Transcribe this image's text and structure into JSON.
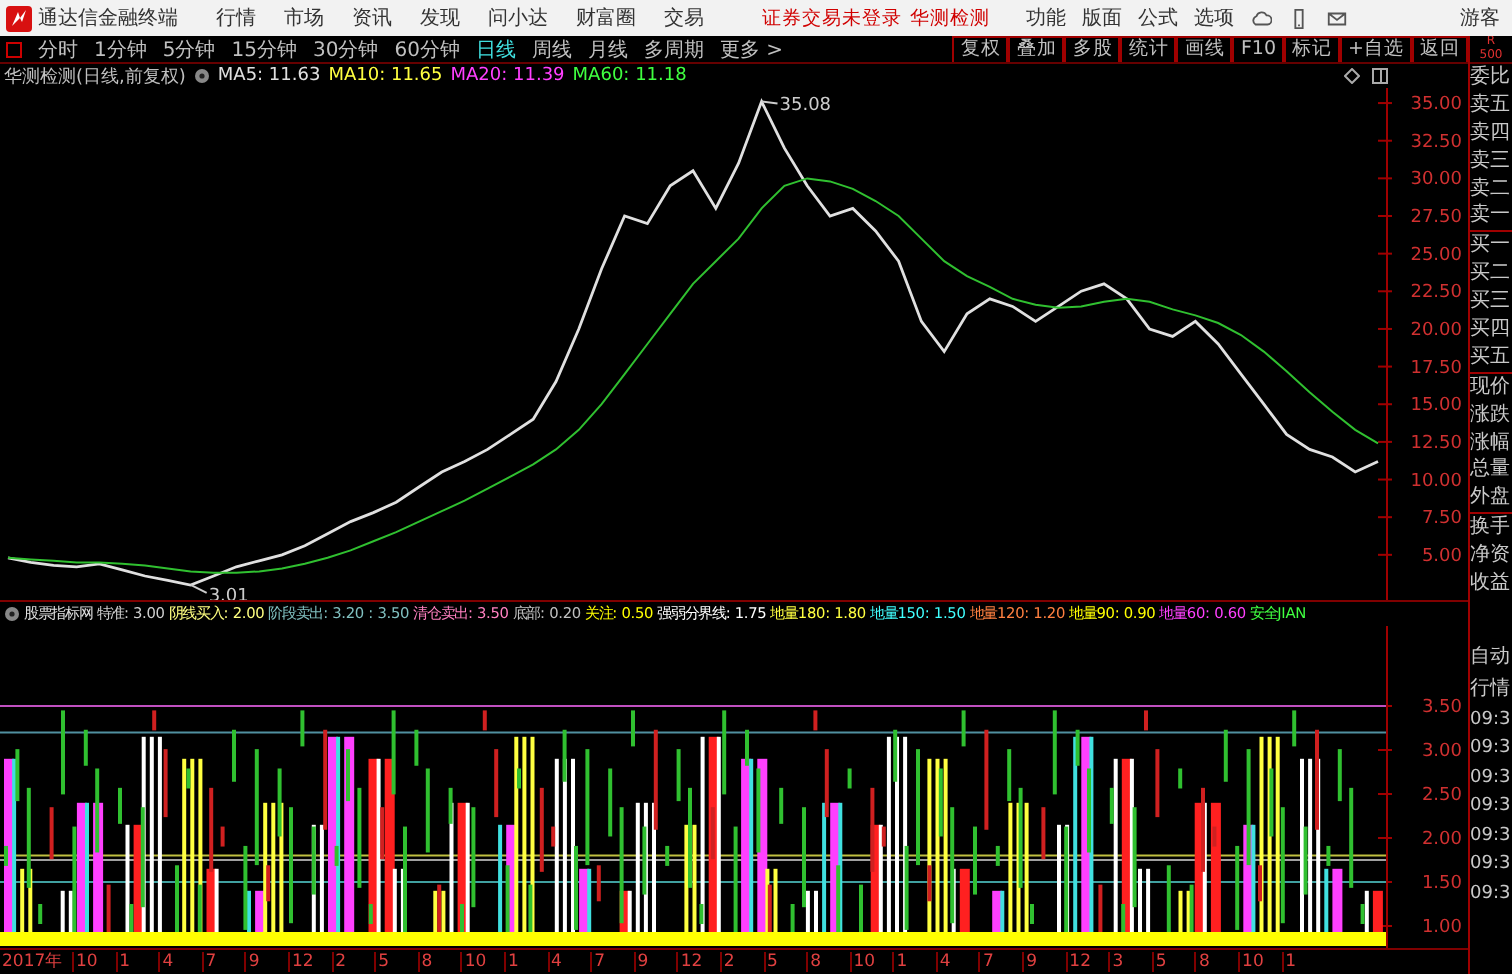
{
  "title_bar": {
    "app_name": "通达信金融终端",
    "menus": [
      "行情",
      "市场",
      "资讯",
      "发现",
      "问小达",
      "财富圈",
      "交易"
    ],
    "notice": "证券交易未登录",
    "stock": "华测检测",
    "tools": [
      "功能",
      "版面",
      "公式",
      "选项"
    ],
    "user": "游客"
  },
  "period_bar": {
    "periods": [
      {
        "label": "分时",
        "selected": false
      },
      {
        "label": "1分钟",
        "selected": false
      },
      {
        "label": "5分钟",
        "selected": false
      },
      {
        "label": "15分钟",
        "selected": false
      },
      {
        "label": "30分钟",
        "selected": false
      },
      {
        "label": "60分钟",
        "selected": false
      },
      {
        "label": "日线",
        "selected": true
      },
      {
        "label": "周线",
        "selected": false
      },
      {
        "label": "月线",
        "selected": false
      },
      {
        "label": "多周期",
        "selected": false
      },
      {
        "label": "更多 >",
        "selected": false
      }
    ],
    "actions": [
      "复权",
      "叠加",
      "多股",
      "统计",
      "画线",
      "F10",
      "标记",
      "+自选",
      "返回"
    ]
  },
  "price_pane": {
    "title": "华测检测(日线,前复权)",
    "ma": [
      {
        "label": "MA5: 11.63",
        "color": "#e0e0e0"
      },
      {
        "label": "MA10: 11.65",
        "color": "#ffff40"
      },
      {
        "label": "MA20: 11.39",
        "color": "#ff40ff"
      },
      {
        "label": "MA60: 11.18",
        "color": "#40ff40"
      }
    ],
    "high_label": "35.08",
    "low_label": "3.01",
    "chart_data": {
      "type": "line",
      "ylim": [
        2,
        36
      ],
      "yticks": [
        {
          "value": 35,
          "label": "35.00"
        },
        {
          "value": 32.5,
          "label": "32.50"
        },
        {
          "value": 30,
          "label": "30.00"
        },
        {
          "value": 27.5,
          "label": "27.50"
        },
        {
          "value": 25,
          "label": "25.00"
        },
        {
          "value": 22.5,
          "label": "22.50"
        },
        {
          "value": 20,
          "label": "20.00"
        },
        {
          "value": 17.5,
          "label": "17.50"
        },
        {
          "value": 15,
          "label": "15.00"
        },
        {
          "value": 12.5,
          "label": "12.50"
        },
        {
          "value": 10,
          "label": "10.00"
        },
        {
          "value": 7.5,
          "label": "7.50"
        },
        {
          "value": 5,
          "label": "5.00"
        }
      ],
      "series": [
        {
          "color": "#e0e0e0",
          "values": [
            4.8,
            4.5,
            4.3,
            4.2,
            4.4,
            4.0,
            3.6,
            3.3,
            3.0,
            3.6,
            4.2,
            4.6,
            5.0,
            5.6,
            6.4,
            7.2,
            7.8,
            8.5,
            9.5,
            10.5,
            11.2,
            12.0,
            13.0,
            14.0,
            16.5,
            20.0,
            24.0,
            27.5,
            27.0,
            29.5,
            30.5,
            28.0,
            31.0,
            35.1,
            32.0,
            29.5,
            27.5,
            28.0,
            26.5,
            24.5,
            20.5,
            18.5,
            21.0,
            22.0,
            21.5,
            20.5,
            21.5,
            22.5,
            23.0,
            22.0,
            20.0,
            19.5,
            20.5,
            19.0,
            17.0,
            15.0,
            13.0,
            12.0,
            11.5,
            10.5,
            11.2
          ]
        },
        {
          "color": "#30c030",
          "values": [
            4.8,
            4.7,
            4.6,
            4.5,
            4.5,
            4.4,
            4.3,
            4.1,
            3.9,
            3.8,
            3.8,
            3.9,
            4.1,
            4.4,
            4.8,
            5.3,
            5.9,
            6.5,
            7.2,
            7.9,
            8.6,
            9.4,
            10.2,
            11.0,
            12.0,
            13.3,
            15.0,
            17.0,
            19.0,
            21.0,
            23.0,
            24.5,
            26.0,
            28.0,
            29.5,
            30.0,
            29.8,
            29.3,
            28.5,
            27.5,
            26.0,
            24.5,
            23.5,
            22.8,
            22.0,
            21.6,
            21.4,
            21.5,
            21.8,
            22.0,
            21.8,
            21.3,
            20.9,
            20.4,
            19.6,
            18.5,
            17.2,
            15.8,
            14.5,
            13.3,
            12.4
          ]
        }
      ]
    }
  },
  "indicator_pane": {
    "name": "股票指标网",
    "legend": [
      {
        "label": "特准: 3.00",
        "color": "#d0d0d0"
      },
      {
        "label": "阴线买入: 2.00",
        "color": "#ffff80"
      },
      {
        "label": "阶段卖出: 3.20 : 3.50",
        "color": "#80c0c0"
      },
      {
        "label": "清仓卖出: 3.50",
        "color": "#ff80c0"
      },
      {
        "label": "底部: 0.20",
        "color": "#c0c0c0"
      },
      {
        "label": "关注: 0.50",
        "color": "#ffff00"
      },
      {
        "label": "强弱分界线: 1.75",
        "color": "#ffffff"
      },
      {
        "label": "地量180: 1.80",
        "color": "#ffff40"
      },
      {
        "label": "地量150: 1.50",
        "color": "#40ffff"
      },
      {
        "label": "地量120: 1.20",
        "color": "#ff8040"
      },
      {
        "label": "地量90: 0.90",
        "color": "#ffff00"
      },
      {
        "label": "地量60: 0.60",
        "color": "#ff40ff"
      },
      {
        "label": "安全JIAN",
        "color": "#40ff40"
      }
    ],
    "axis": [
      "3.50",
      "3.00",
      "2.50",
      "2.00",
      "1.50",
      "1.00"
    ]
  },
  "date_axis": [
    "2017年",
    "10",
    "1",
    "4",
    "7",
    "9",
    "12",
    "2",
    "5",
    "8",
    "10",
    "1",
    "4",
    "7",
    "9",
    "12",
    "2",
    "5",
    "8",
    "10",
    "1",
    "4",
    "7",
    "9",
    "12",
    "3",
    "5",
    "8",
    "10",
    "1"
  ],
  "side_panel": {
    "header": [
      "R",
      "500"
    ],
    "quote_labels": [
      "委比",
      "卖五",
      "卖四",
      "卖三",
      "卖二",
      "卖一",
      "买一",
      "买二",
      "买三",
      "买四",
      "买五",
      "现价",
      "涨跌",
      "涨幅",
      "总量",
      "外盘",
      "换手",
      "净资",
      "收益"
    ],
    "bottom_labels": [
      "自动",
      "行情"
    ],
    "times": [
      "09:3",
      "09:3",
      "09:3",
      "09:3",
      "09:3",
      "09:3",
      "09:3"
    ]
  }
}
